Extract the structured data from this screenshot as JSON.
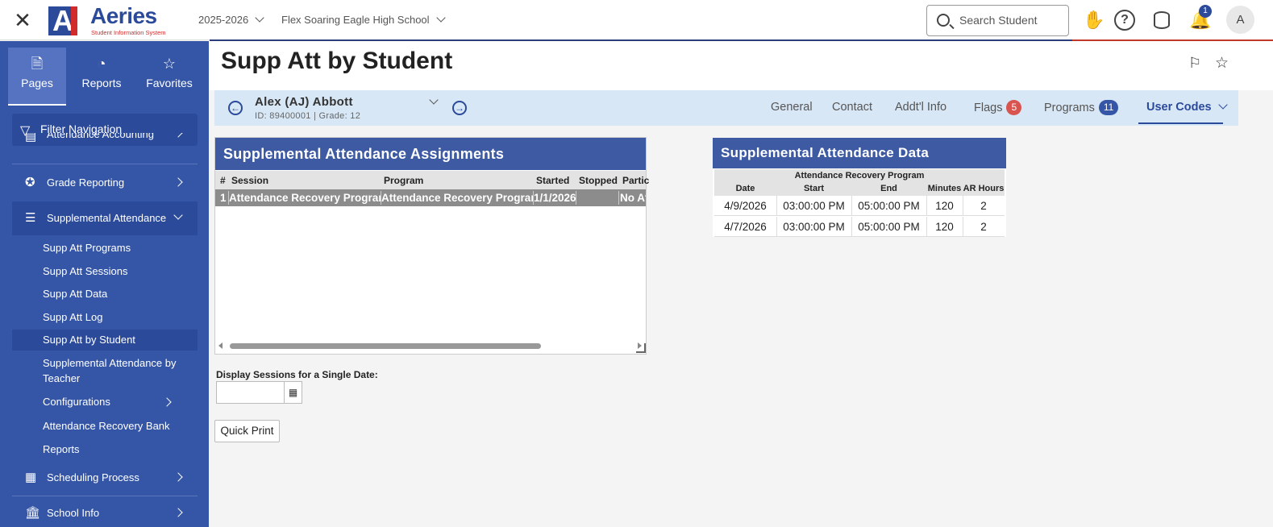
{
  "header": {
    "close_icon": "close-icon",
    "logo_text": "Aeries",
    "logo_sub": "Student Information System",
    "logo_mark": "A",
    "year": "2025-2026",
    "school": "Flex Soaring Eagle High School",
    "search_placeholder": "Search Student",
    "notification_count": "1",
    "avatar_letter": "A"
  },
  "sidebar": {
    "tabs": [
      {
        "label": "Pages",
        "icon": "page-icon",
        "active": true
      },
      {
        "label": "Reports",
        "icon": "pie-chart-icon"
      },
      {
        "label": "Favorites",
        "icon": "star-icon"
      }
    ],
    "filter_label": "Filter Navigation",
    "items": [
      {
        "label": "Attendance Accounting"
      },
      {
        "label": "Grade Reporting"
      },
      {
        "label": "Supplemental Attendance"
      },
      {
        "label": "Scheduling Process"
      },
      {
        "label": "School Info"
      }
    ],
    "sub_items": [
      {
        "label": "Supp Att Programs"
      },
      {
        "label": "Supp Att Sessions"
      },
      {
        "label": "Supp Att Data"
      },
      {
        "label": "Supp Att Log"
      },
      {
        "label": "Supp Att by Student"
      },
      {
        "label": "Supplemental Attendance by Teacher"
      },
      {
        "label": "Configurations"
      },
      {
        "label": "Attendance Recovery Bank"
      },
      {
        "label": "Reports"
      }
    ]
  },
  "page": {
    "title": "Supp Att by Student"
  },
  "student": {
    "name": "Alex (AJ) Abbott",
    "meta": "ID: 89400001 |  Grade: 12",
    "tabs": [
      {
        "label": "General"
      },
      {
        "label": "Contact"
      },
      {
        "label": "Addt'l Info"
      },
      {
        "label": "Flags",
        "badge": "5"
      },
      {
        "label": "Programs",
        "badge": "11"
      },
      {
        "label": "User Codes"
      }
    ]
  },
  "assignments": {
    "title": "Supplemental Attendance Assignments",
    "columns": [
      "#",
      "Session",
      "Program",
      "Started",
      "Stopped",
      "Partic"
    ],
    "rows": [
      {
        "num": "1",
        "session": "Attendance Recovery Program",
        "program": "Attendance Recovery Program",
        "started": "1/1/2026",
        "stopped": "",
        "partic": "No At"
      }
    ]
  },
  "att_data": {
    "title": "Supplemental Attendance Data",
    "program": "Attendance Recovery Program",
    "columns": [
      "Date",
      "Start",
      "End",
      "Minutes",
      "AR Hours"
    ],
    "rows": [
      {
        "date": "4/9/2026",
        "start": "03:00:00 PM",
        "end": "05:00:00 PM",
        "minutes": "120",
        "hours": "2"
      },
      {
        "date": "4/7/2026",
        "start": "03:00:00 PM",
        "end": "05:00:00 PM",
        "minutes": "120",
        "hours": "2"
      }
    ]
  },
  "controls": {
    "date_label": "Display Sessions for a Single Date:",
    "date_value": "",
    "quick_print": "Quick Print"
  },
  "colors": {
    "brand_blue": "#2b4a9a",
    "sidebar_blue": "#3556a6",
    "flag_badge": "#d9534f"
  }
}
